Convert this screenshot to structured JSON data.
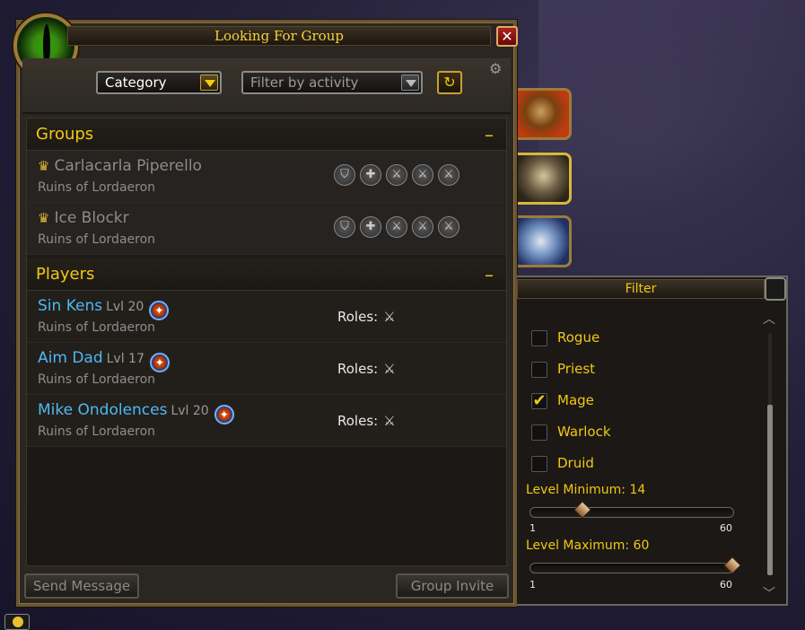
{
  "window": {
    "title": "Looking For Group"
  },
  "toolbar": {
    "category_label": "Category",
    "activity_placeholder": "Filter by activity"
  },
  "groups": {
    "heading": "Groups",
    "collapse": "–",
    "items": [
      {
        "name": "Carlacarla Piperello",
        "location": "Ruins of Lordaeron"
      },
      {
        "name": "Ice Blockr",
        "location": "Ruins of Lordaeron"
      }
    ]
  },
  "players": {
    "heading": "Players",
    "collapse": "–",
    "roles_label": "Roles:",
    "items": [
      {
        "name": "Sin Kens",
        "level": "Lvl 20",
        "location": "Ruins of Lordaeron"
      },
      {
        "name": "Aim Dad",
        "level": "Lvl 17",
        "location": "Ruins of Lordaeron"
      },
      {
        "name": "Mike Ondolences",
        "level": "Lvl 20",
        "location": "Ruins of Lordaeron"
      }
    ]
  },
  "buttons": {
    "send_message": "Send Message",
    "group_invite": "Group Invite"
  },
  "filter": {
    "title": "Filter",
    "classes": [
      {
        "label": "Rogue",
        "checked": false
      },
      {
        "label": "Priest",
        "checked": false
      },
      {
        "label": "Mage",
        "checked": true
      },
      {
        "label": "Warlock",
        "checked": false
      },
      {
        "label": "Druid",
        "checked": false
      }
    ],
    "level_min": {
      "label": "Level Minimum: 14",
      "value": 14,
      "min": 1,
      "max": 60,
      "min_tick": "1",
      "max_tick": "60"
    },
    "level_max": {
      "label": "Level Maximum: 60",
      "value": 60,
      "min": 1,
      "max": 60,
      "min_tick": "1",
      "max_tick": "60"
    }
  },
  "icons": {
    "checkmark": "✔",
    "crown": "♛",
    "shield": "⛉",
    "plus": "✚",
    "sword": "⚔",
    "refresh": "↻",
    "gear": "⚙",
    "close": "✕",
    "scroll_up": "︿",
    "scroll_down": "﹀",
    "class_badge": "✦"
  },
  "colors": {
    "gold": "#f2c812",
    "player_name": "#4fb8f0",
    "muted": "#8c8c8c"
  }
}
